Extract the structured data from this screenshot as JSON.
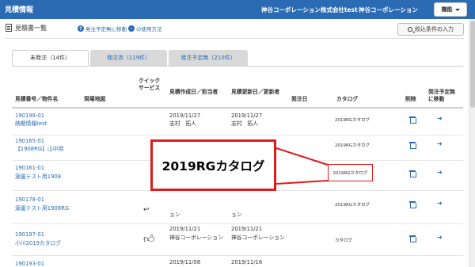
{
  "header": {
    "brand": "見積情報",
    "company": "神谷コーポレーション株式会社test",
    "user": "神谷コーポレーション",
    "menu_label": "機能"
  },
  "toolbar": {
    "page_title": "見積書一覧",
    "help_link1": "発注予定無に移動",
    "help_link2": "の使用方法",
    "filter_button": "絞込条件の入力"
  },
  "tabs": [
    {
      "label": "未発注（14件）",
      "active": true
    },
    {
      "label": "発注済（119件）",
      "active": false
    },
    {
      "label": "発注予定無（210件）",
      "active": false
    }
  ],
  "table": {
    "headers": {
      "number": "見積番号／物件名",
      "map": "現場地図",
      "quick": "クイックサービス",
      "created": "見積作成日／担当者",
      "updated": "見積更新日／更新者",
      "ordered": "発注日",
      "catalog": "カタログ",
      "delete": "削除",
      "move": "発注予定無に移動"
    },
    "rows": [
      {
        "number": "190198-01",
        "name": "納期情報test",
        "created_date": "2019/11/27",
        "created_by": "志村　拓人",
        "updated_date": "2019/11/27",
        "updated_by": "志村　拓人",
        "catalog": "2019RGカタログ"
      },
      {
        "number": "190165-01",
        "name": "【1908RG】山中用",
        "created_date": "",
        "created_by": "",
        "updated_date": "",
        "updated_by": "",
        "catalog": "2019RGカタログ"
      },
      {
        "number": "190161-01",
        "name": "源邊テスト用1908",
        "created_date": "",
        "created_by": "",
        "updated_date": "",
        "updated_by": "",
        "catalog": "2019RGカタログ"
      },
      {
        "number": "190178-01",
        "name": "源邊テスト用1908RG",
        "created_date": "",
        "created_by": "ョン",
        "updated_date": "",
        "updated_by": "ョン",
        "catalog": "2019RGカタログ"
      },
      {
        "number": "190197-01",
        "name": "小川2019カタログ",
        "created_date": "2019/11/21",
        "created_by": "神谷コーポレーション",
        "updated_date": "2019/11/21",
        "updated_by": "神谷コーポレーション",
        "catalog": "カタログ"
      },
      {
        "number": "190193-01",
        "name": "",
        "created_date": "2019/11/08",
        "created_by": "",
        "updated_date": "2019/11/16",
        "updated_by": "",
        "catalog": ""
      }
    ]
  },
  "callout": {
    "label": "2019RGカタログ",
    "target": "2019RGカタログ"
  }
}
